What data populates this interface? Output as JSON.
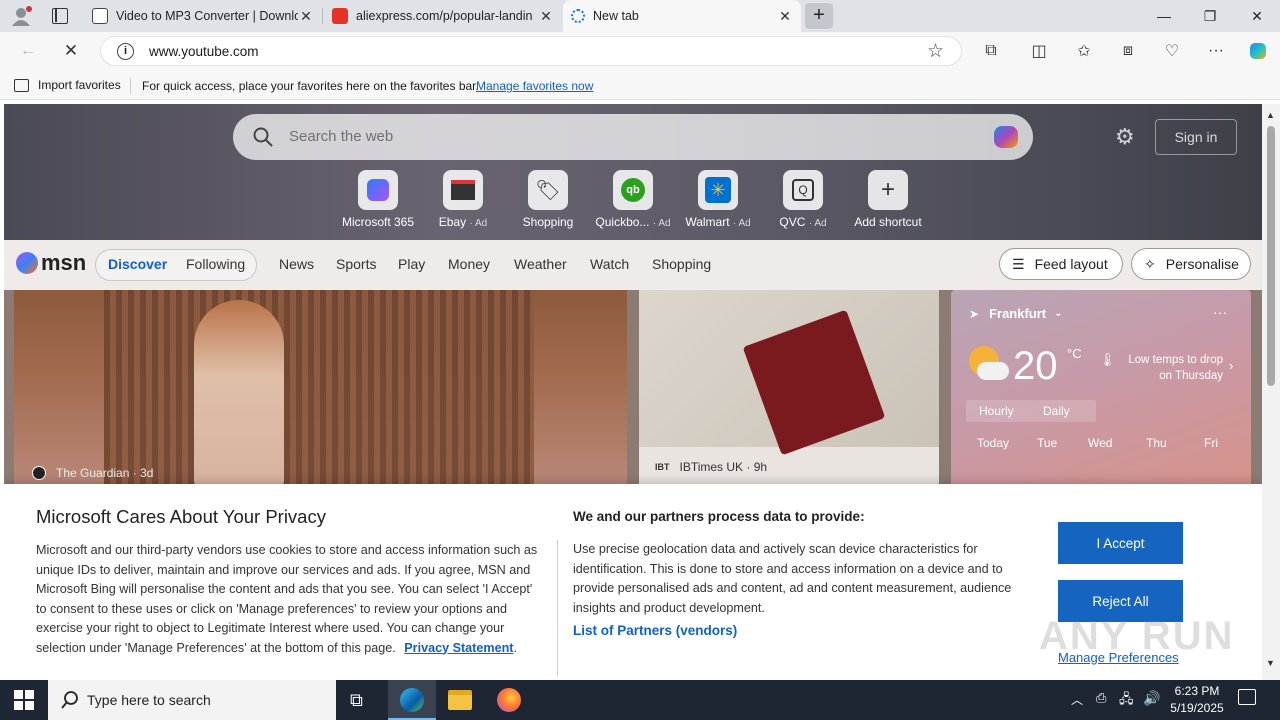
{
  "tabs": [
    {
      "title": "Video to MP3 Converter | Downlo",
      "close": "✕"
    },
    {
      "title": "aliexpress.com/p/popular-landin",
      "close": "✕"
    },
    {
      "title": "New tab",
      "close": "✕"
    }
  ],
  "new_tab_label": "+",
  "address": {
    "url": "www.youtube.com"
  },
  "favorites_bar": {
    "import_label": "Import favorites",
    "hint": "For quick access, place your favorites here on the favorites bar.",
    "manage_link": "Manage favorites now"
  },
  "newtab": {
    "search_placeholder": "Search the web",
    "sign_in": "Sign in",
    "shortcuts": [
      {
        "label": "Microsoft 365",
        "ad": ""
      },
      {
        "label": "Ebay",
        "ad": "· Ad"
      },
      {
        "label": "Shopping",
        "ad": ""
      },
      {
        "label": "Quickbo...",
        "ad": "· Ad"
      },
      {
        "label": "Walmart",
        "ad": "· Ad"
      },
      {
        "label": "QVC",
        "ad": "· Ad"
      },
      {
        "label": "Add shortcut",
        "ad": ""
      }
    ]
  },
  "msn": {
    "brand": "msn",
    "tabs": [
      "Discover",
      "Following"
    ],
    "nav": [
      "News",
      "Sports",
      "Play",
      "Money",
      "Weather",
      "Watch",
      "Shopping"
    ],
    "feed_layout": "Feed layout",
    "personalise": "Personalise"
  },
  "cards": {
    "card1_source": "The Guardian · 3d",
    "card2_source_badge": "IBT",
    "card2_source": "IBTimes UK · 9h"
  },
  "weather": {
    "city": "Frankfurt",
    "temp": "20",
    "unit": "°C",
    "note": "Low temps to drop on Thursday",
    "modes": [
      "Hourly",
      "Daily"
    ],
    "days": [
      "Today",
      "Tue",
      "Wed",
      "Thu",
      "Fri"
    ]
  },
  "privacy": {
    "title": "Microsoft Cares About Your Privacy",
    "body": "Microsoft and our third-party vendors use cookies to store and access information such as unique IDs to deliver, maintain and improve our services and ads. If you agree, MSN and Microsoft Bing will personalise the content and ads that you see. You can select 'I Accept' to consent to these uses or click on 'Manage preferences' to review your options and exercise your right to object to Legitimate Interest where used. You can change your selection under 'Manage Preferences' at the bottom of this page.",
    "privacy_link": "Privacy Statement",
    "right_title": "We and our partners process data to provide:",
    "right_body": "Use precise geolocation data and actively scan device characteristics for identification. This is done to store and access information on a device and to provide personalised ads and content, ad and content measurement, audience insights and product development.",
    "partners_link": "List of Partners (vendors)",
    "accept": "I Accept",
    "reject": "Reject All",
    "manage": "Manage Preferences"
  },
  "watermark": "ANY RUN",
  "taskbar": {
    "search_placeholder": "Type here to search",
    "time": "6:23 PM",
    "date": "5/19/2025"
  },
  "colors": {
    "accent": "#1565c0",
    "link": "#0f5fcd",
    "taskbar": "#1f2633"
  }
}
